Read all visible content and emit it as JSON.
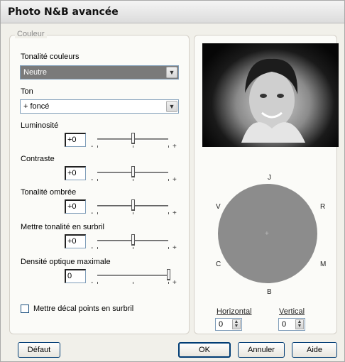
{
  "window": {
    "title": "Photo N&B avancée"
  },
  "left": {
    "group_label": "Couleur",
    "tone_color_label": "Tonalité couleurs",
    "tone_color_value": "Neutre",
    "ton_label": "Ton",
    "ton_value": "+ foncé",
    "sliders": [
      {
        "label": "Luminosité",
        "value": "+0",
        "level": 0.5
      },
      {
        "label": "Contraste",
        "value": "+0",
        "level": 0.5
      },
      {
        "label": "Tonalité ombrée",
        "value": "+0",
        "level": 0.5
      },
      {
        "label": "Mettre tonalité en surbril",
        "value": "+0",
        "level": 0.5
      },
      {
        "label": "Densité optique maximale",
        "value": "0",
        "level": 1.0
      }
    ],
    "minus": "-",
    "plus": "+",
    "checkbox_label": "Mettre décal points en surbril",
    "checkbox_checked": false
  },
  "right": {
    "wheel_labels": {
      "top": "J",
      "bottom": "B",
      "left_top": "V",
      "right_top": "R",
      "left_bottom": "C",
      "right_bottom": "M"
    },
    "center_mark": "+",
    "horizontal_label": "Horizontal",
    "horizontal_value": "0",
    "vertical_label": "Vertical",
    "vertical_value": "0"
  },
  "buttons": {
    "default": "Défaut",
    "ok": "OK",
    "cancel": "Annuler",
    "help": "Aide"
  },
  "colors": {
    "accent": "#7a7a7a",
    "wheel": "#8c8c8c"
  }
}
